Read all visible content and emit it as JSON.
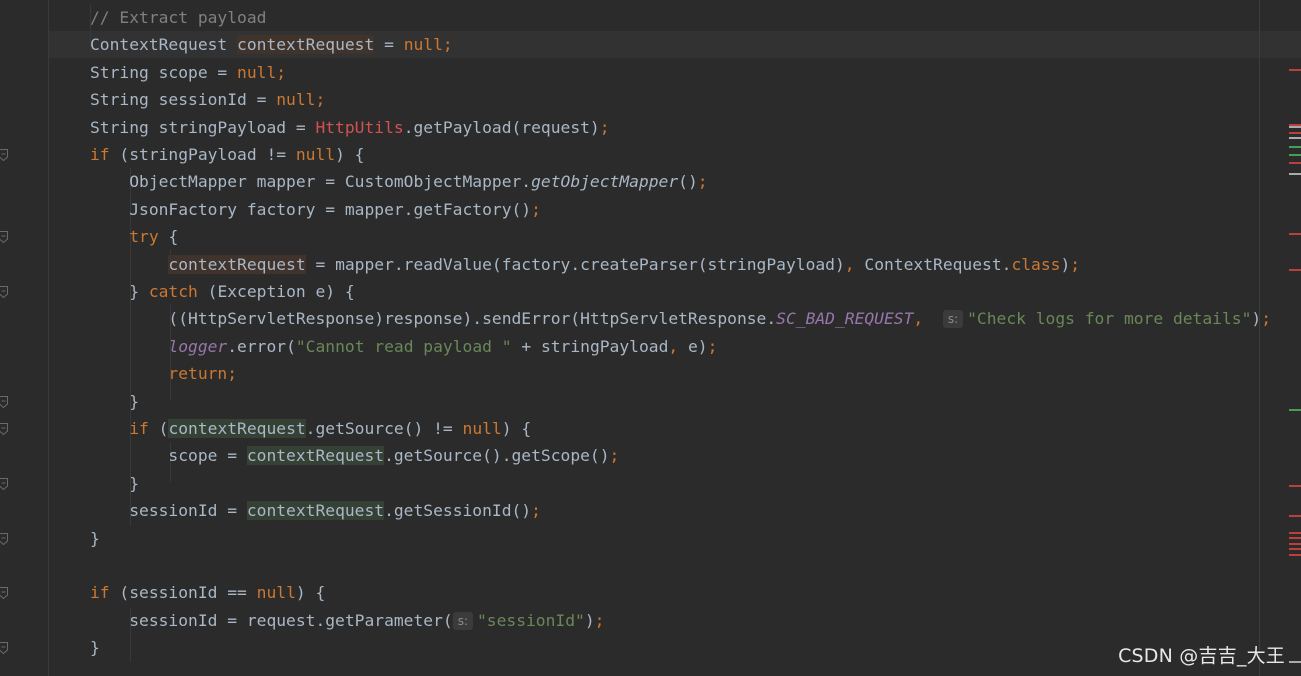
{
  "editor": {
    "lines": [
      {
        "tokens": [
          {
            "t": "// Extract payload",
            "c": "cmt"
          }
        ]
      },
      {
        "tokens": [
          {
            "t": "ContextRequest "
          },
          {
            "t": "contextRequest",
            "c": "var-write"
          },
          {
            "t": " = "
          },
          {
            "t": "null",
            "c": "kw"
          },
          {
            "t": ";",
            "c": "kw"
          }
        ]
      },
      {
        "tokens": [
          {
            "t": "String scope = "
          },
          {
            "t": "null",
            "c": "kw"
          },
          {
            "t": ";",
            "c": "kw"
          }
        ]
      },
      {
        "tokens": [
          {
            "t": "String sessionId = "
          },
          {
            "t": "null",
            "c": "kw"
          },
          {
            "t": ";",
            "c": "kw"
          }
        ]
      },
      {
        "tokens": [
          {
            "t": "String stringPayload = "
          },
          {
            "t": "HttpUtils",
            "c": "cls-err"
          },
          {
            "t": ".getPayload(request)"
          },
          {
            "t": ";",
            "c": "kw"
          }
        ]
      },
      {
        "tokens": [
          {
            "t": "if",
            "c": "kw"
          },
          {
            "t": " (stringPayload != "
          },
          {
            "t": "null",
            "c": "kw"
          },
          {
            "t": ") {"
          }
        ]
      },
      {
        "tokens": [
          {
            "t": "    ObjectMapper mapper = CustomObjectMapper."
          },
          {
            "t": "getObjectMapper",
            "c": "ital"
          },
          {
            "t": "()"
          },
          {
            "t": ";",
            "c": "kw"
          }
        ]
      },
      {
        "tokens": [
          {
            "t": "    JsonFactory factory = mapper.getFactory()"
          },
          {
            "t": ";",
            "c": "kw"
          }
        ]
      },
      {
        "tokens": [
          {
            "t": "    "
          },
          {
            "t": "try",
            "c": "kw"
          },
          {
            "t": " {"
          }
        ]
      },
      {
        "tokens": [
          {
            "t": "        "
          },
          {
            "t": "contextRequest",
            "c": "var-write"
          },
          {
            "t": " = mapper.readValue(factory.createParser(stringPayload)"
          },
          {
            "t": ",",
            "c": "kw"
          },
          {
            "t": " ContextRequest."
          },
          {
            "t": "class",
            "c": "kw"
          },
          {
            "t": ")"
          },
          {
            "t": ";",
            "c": "kw"
          }
        ]
      },
      {
        "tokens": [
          {
            "t": "    } "
          },
          {
            "t": "catch",
            "c": "kw"
          },
          {
            "t": " (Exception e) {"
          }
        ]
      },
      {
        "tokens": [
          {
            "t": "        ((HttpServletResponse)response).sendError(HttpServletResponse."
          },
          {
            "t": "SC_BAD_REQUEST",
            "c": "const"
          },
          {
            "t": ",",
            "c": "kw"
          },
          {
            "t": "  "
          },
          {
            "t": "s:",
            "c": "hint"
          },
          {
            "t": "\"Check logs for more details\"",
            "c": "str"
          },
          {
            "t": ")"
          },
          {
            "t": ";",
            "c": "kw"
          }
        ]
      },
      {
        "tokens": [
          {
            "t": "        "
          },
          {
            "t": "logger",
            "c": "const"
          },
          {
            "t": ".error("
          },
          {
            "t": "\"Cannot read payload \"",
            "c": "str"
          },
          {
            "t": " + stringPayload"
          },
          {
            "t": ",",
            "c": "kw"
          },
          {
            "t": " e)"
          },
          {
            "t": ";",
            "c": "kw"
          }
        ]
      },
      {
        "tokens": [
          {
            "t": "        "
          },
          {
            "t": "return;",
            "c": "kw"
          }
        ]
      },
      {
        "tokens": [
          {
            "t": "    }"
          }
        ]
      },
      {
        "tokens": [
          {
            "t": "    "
          },
          {
            "t": "if",
            "c": "kw"
          },
          {
            "t": " ("
          },
          {
            "t": "contextRequest",
            "c": "var-read"
          },
          {
            "t": ".getSource() != "
          },
          {
            "t": "null",
            "c": "kw"
          },
          {
            "t": ") {"
          }
        ]
      },
      {
        "tokens": [
          {
            "t": "        scope = "
          },
          {
            "t": "contextRequest",
            "c": "var-read"
          },
          {
            "t": ".getSource().getScope()"
          },
          {
            "t": ";",
            "c": "kw"
          }
        ]
      },
      {
        "tokens": [
          {
            "t": "    }"
          }
        ]
      },
      {
        "tokens": [
          {
            "t": "    sessionId = "
          },
          {
            "t": "contextRequest",
            "c": "var-read"
          },
          {
            "t": ".getSessionId()"
          },
          {
            "t": ";",
            "c": "kw"
          }
        ]
      },
      {
        "tokens": [
          {
            "t": "}"
          }
        ]
      },
      {
        "tokens": []
      },
      {
        "tokens": [
          {
            "t": "if",
            "c": "kw"
          },
          {
            "t": " (sessionId == "
          },
          {
            "t": "null",
            "c": "kw"
          },
          {
            "t": ") {"
          }
        ]
      },
      {
        "tokens": [
          {
            "t": "    sessionId = request.getParameter("
          },
          {
            "t": "s:",
            "c": "hint"
          },
          {
            "t": "\"sessionId\"",
            "c": "str"
          },
          {
            "t": ")"
          },
          {
            "t": ";",
            "c": "kw"
          }
        ]
      },
      {
        "tokens": [
          {
            "t": "}"
          }
        ]
      }
    ]
  },
  "gutter": {
    "fold_marker_lines": [
      5,
      8,
      10,
      14,
      15,
      17,
      19,
      21,
      23
    ]
  },
  "stripe": {
    "colors": {
      "error": "#bc3f3c",
      "warning": "#be9117",
      "ok": "#499c54",
      "info": "#aaaaaa"
    },
    "marks": [
      {
        "line": 2,
        "kind": "error"
      },
      {
        "line": 4,
        "kind": "error"
      },
      {
        "line": 4.1,
        "kind": "info"
      },
      {
        "line": 4.3,
        "kind": "error"
      },
      {
        "line": 4.5,
        "kind": "info"
      },
      {
        "line": 4.8,
        "kind": "ok"
      },
      {
        "line": 5.1,
        "kind": "ok"
      },
      {
        "line": 5.4,
        "kind": "error"
      },
      {
        "line": 5.8,
        "kind": "info"
      },
      {
        "line": 8,
        "kind": "error"
      },
      {
        "line": 9.3,
        "kind": "error"
      },
      {
        "line": 14.4,
        "kind": "ok"
      },
      {
        "line": 17.2,
        "kind": "error"
      },
      {
        "line": 18.3,
        "kind": "error"
      },
      {
        "line": 18.9,
        "kind": "error"
      },
      {
        "line": 19.1,
        "kind": "error"
      },
      {
        "line": 19.3,
        "kind": "error"
      },
      {
        "line": 19.5,
        "kind": "error"
      },
      {
        "line": 19.7,
        "kind": "error"
      },
      {
        "line": 23.6,
        "kind": "info"
      }
    ]
  },
  "watermark": {
    "text": "CSDN @吉吉_大王"
  }
}
